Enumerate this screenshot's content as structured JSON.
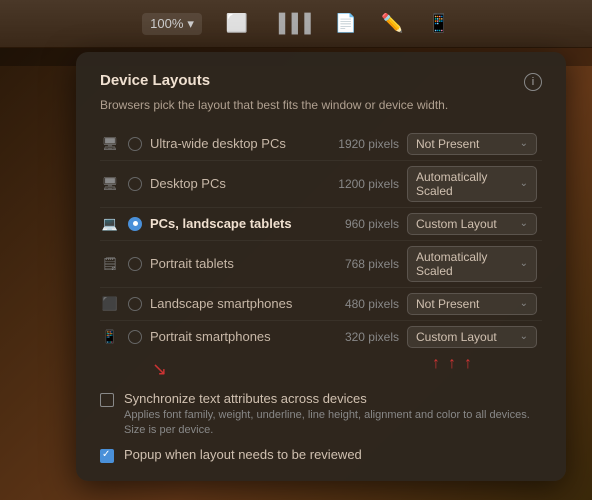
{
  "toolbar": {
    "zoom_label": "100%",
    "zoom_icon": "▾"
  },
  "panel": {
    "title": "Device Layouts",
    "subtitle": "Browsers pick the layout that best fits the window or device width.",
    "info_icon": "i",
    "devices": [
      {
        "id": "ultra-wide",
        "icon": "🖥",
        "name": "Ultra-wide desktop PCs",
        "pixels": "1920 pixels",
        "status": "Not Present",
        "active": false
      },
      {
        "id": "desktop",
        "icon": "🖥",
        "name": "Desktop PCs",
        "pixels": "1200 pixels",
        "status": "Automatically Scaled",
        "active": false
      },
      {
        "id": "landscape-tablet",
        "icon": "💻",
        "name": "PCs, landscape tablets",
        "pixels": "960 pixels",
        "status": "Custom Layout",
        "active": true
      },
      {
        "id": "portrait-tablet",
        "icon": "📱",
        "name": "Portrait tablets",
        "pixels": "768 pixels",
        "status": "Automatically Scaled",
        "active": false
      },
      {
        "id": "landscape-smartphone",
        "icon": "📱",
        "name": "Landscape smartphones",
        "pixels": "480 pixels",
        "status": "Not Present",
        "active": false
      },
      {
        "id": "portrait-smartphone",
        "icon": "📱",
        "name": "Portrait smartphones",
        "pixels": "320 pixels",
        "status": "Custom Layout",
        "active": false
      }
    ],
    "sync": {
      "label": "Synchronize text attributes across devices",
      "desc": "Applies font family, weight, underline, line height, alignment and color\nto all devices. Size is per device.",
      "checked": false
    },
    "popup": {
      "label": "Popup when layout needs to be reviewed",
      "checked": true
    }
  }
}
